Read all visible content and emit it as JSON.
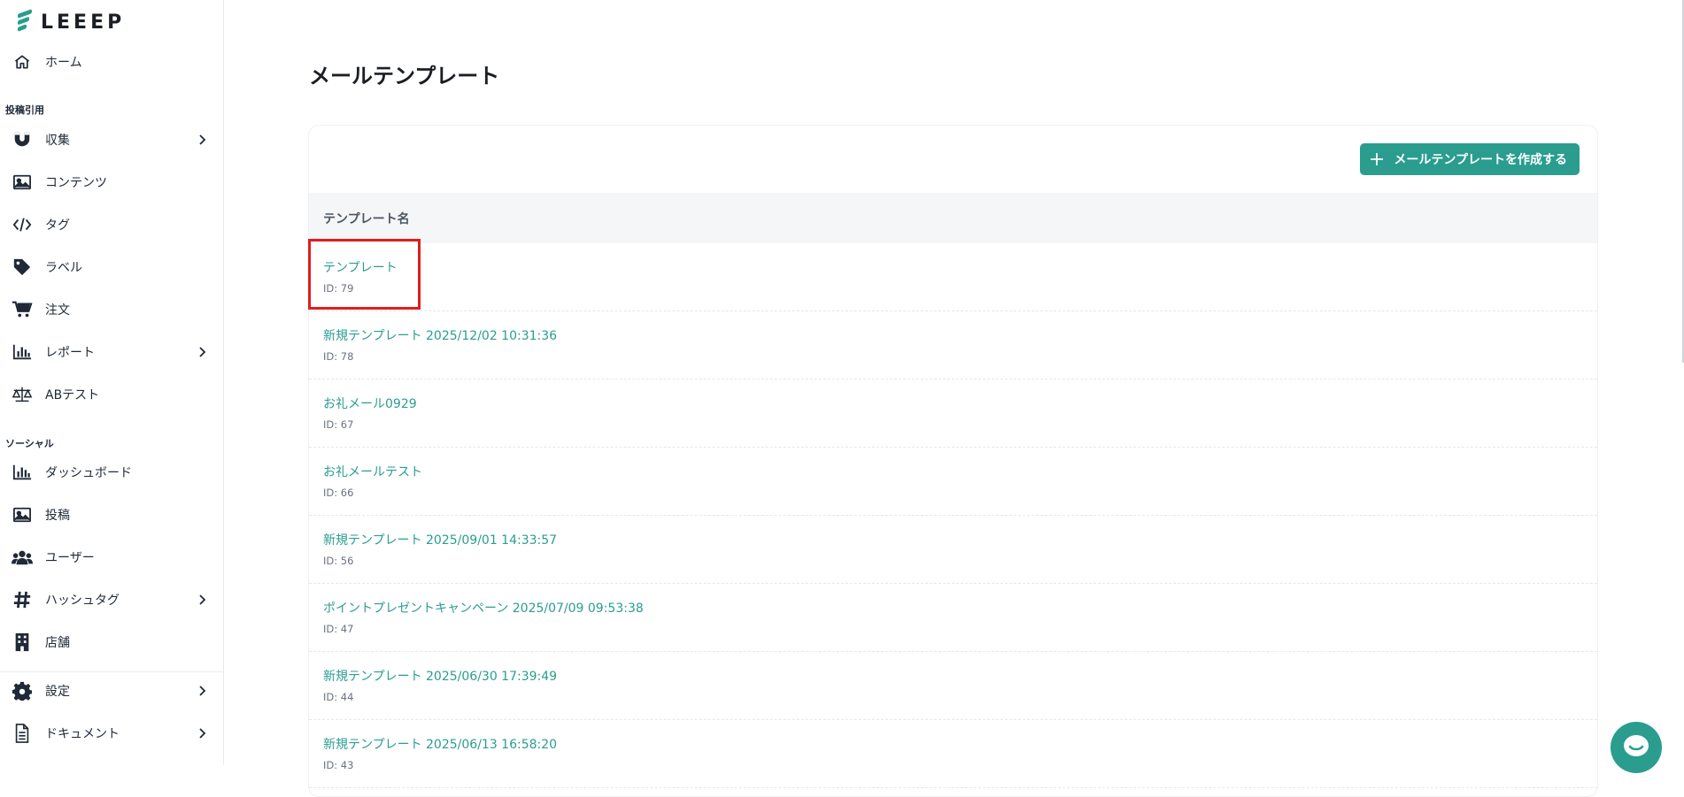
{
  "brand": {
    "name": "LEEEP",
    "accent": "#2a9d8f"
  },
  "sidebar": {
    "home": "ホーム",
    "section_posts": "投稿引用",
    "posts_items": [
      {
        "label": "収集",
        "icon": "magnet-icon",
        "has_children": true
      },
      {
        "label": "コンテンツ",
        "icon": "image-icon",
        "has_children": false
      },
      {
        "label": "タグ",
        "icon": "code-icon",
        "has_children": false
      },
      {
        "label": "ラベル",
        "icon": "tag-icon",
        "has_children": false
      },
      {
        "label": "注文",
        "icon": "cart-icon",
        "has_children": false
      },
      {
        "label": "レポート",
        "icon": "bar-chart-icon",
        "has_children": true
      },
      {
        "label": "ABテスト",
        "icon": "scale-icon",
        "has_children": false
      }
    ],
    "section_social": "ソーシャル",
    "social_items": [
      {
        "label": "ダッシュボード",
        "icon": "bar-chart-icon",
        "has_children": false
      },
      {
        "label": "投稿",
        "icon": "image-icon",
        "has_children": false
      },
      {
        "label": "ユーザー",
        "icon": "users-icon",
        "has_children": false
      },
      {
        "label": "ハッシュタグ",
        "icon": "hashtag-icon",
        "has_children": true
      },
      {
        "label": "店舗",
        "icon": "building-icon",
        "has_children": false
      }
    ],
    "footer_items": [
      {
        "label": "設定",
        "icon": "gear-icon",
        "has_children": true
      },
      {
        "label": "ドキュメント",
        "icon": "document-icon",
        "has_children": true
      }
    ]
  },
  "main": {
    "title": "メールテンプレート",
    "create_button": "メールテンプレートを作成する",
    "column_header": "テンプレート名",
    "rows": [
      {
        "name": "テンプレート",
        "id": "ID: 79"
      },
      {
        "name": "新規テンプレート 2025/12/02 10:31:36",
        "id": "ID: 78"
      },
      {
        "name": "お礼メール0929",
        "id": "ID: 67"
      },
      {
        "name": "お礼メールテスト",
        "id": "ID: 66"
      },
      {
        "name": "新規テンプレート 2025/09/01 14:33:57",
        "id": "ID: 56"
      },
      {
        "name": "ポイントプレゼントキャンペーン 2025/07/09 09:53:38",
        "id": "ID: 47"
      },
      {
        "name": "新規テンプレート 2025/06/30 17:39:49",
        "id": "ID: 44"
      },
      {
        "name": "新規テンプレート 2025/06/13 16:58:20",
        "id": "ID: 43"
      }
    ]
  }
}
